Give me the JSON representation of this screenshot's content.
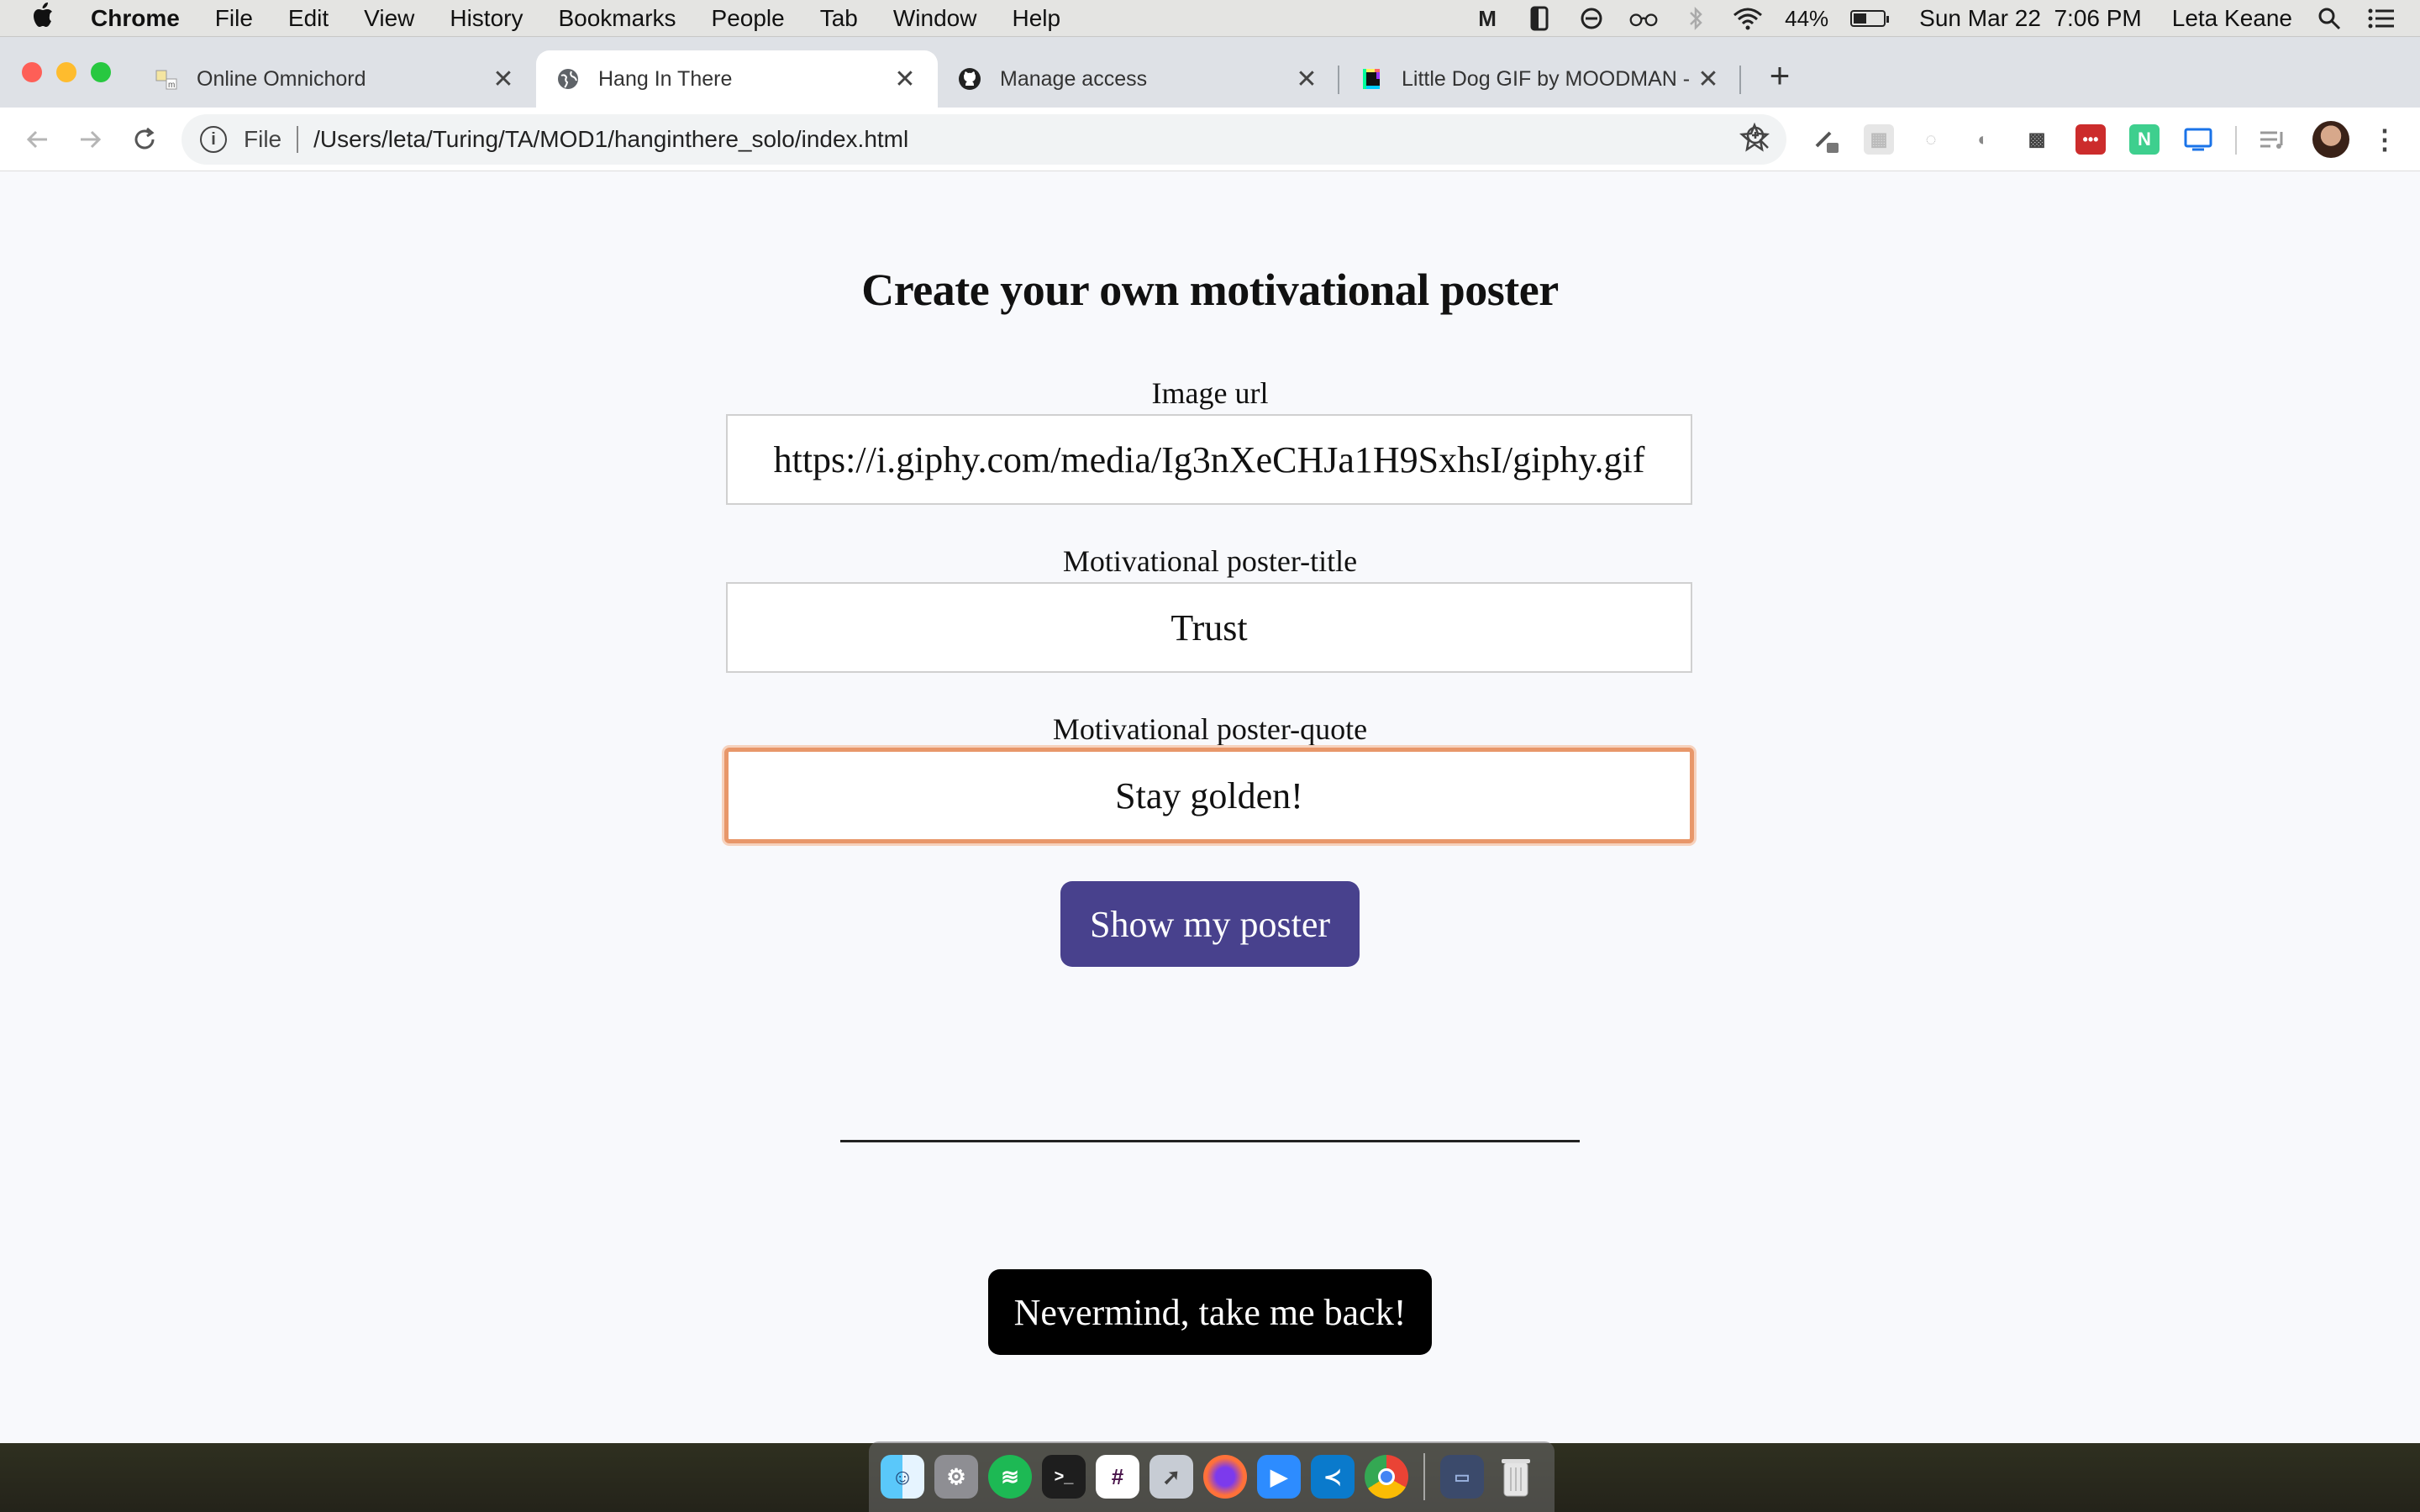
{
  "menubar": {
    "app_name": "Chrome",
    "items": [
      "File",
      "Edit",
      "View",
      "History",
      "Bookmarks",
      "People",
      "Tab",
      "Window",
      "Help"
    ],
    "battery_percent": "44%",
    "battery_level": 0.44,
    "datetime": "Sun Mar 22  7:06 PM",
    "user": "Leta Keane"
  },
  "tabs": [
    {
      "title": "Online Omnichord",
      "icon": "omnichord-favicon"
    },
    {
      "title": "Hang In There",
      "icon": "globe-icon",
      "active": true
    },
    {
      "title": "Manage access",
      "icon": "github-icon"
    },
    {
      "title": "Little Dog GIF by MOODMAN - F",
      "icon": "giphy-favicon"
    }
  ],
  "toolbar": {
    "scheme": "File",
    "url": "/Users/leta/Turing/TA/MOD1/hanginthere_solo/index.html"
  },
  "page": {
    "heading": "Create your own motivational poster",
    "image_url_label": "Image url",
    "image_url_value": "https://i.giphy.com/media/Ig3nXeCHJa1H9SxhsI/giphy.gif",
    "title_label": "Motivational poster-title",
    "title_value": "Trust",
    "quote_label": "Motivational poster-quote",
    "quote_value": "Stay golden!",
    "show_button": "Show my poster",
    "back_button": "Nevermind, take me back!"
  },
  "colors": {
    "show_button_bg": "#48418d",
    "back_button_bg": "#000000",
    "focus_ring": "#e8976a"
  }
}
